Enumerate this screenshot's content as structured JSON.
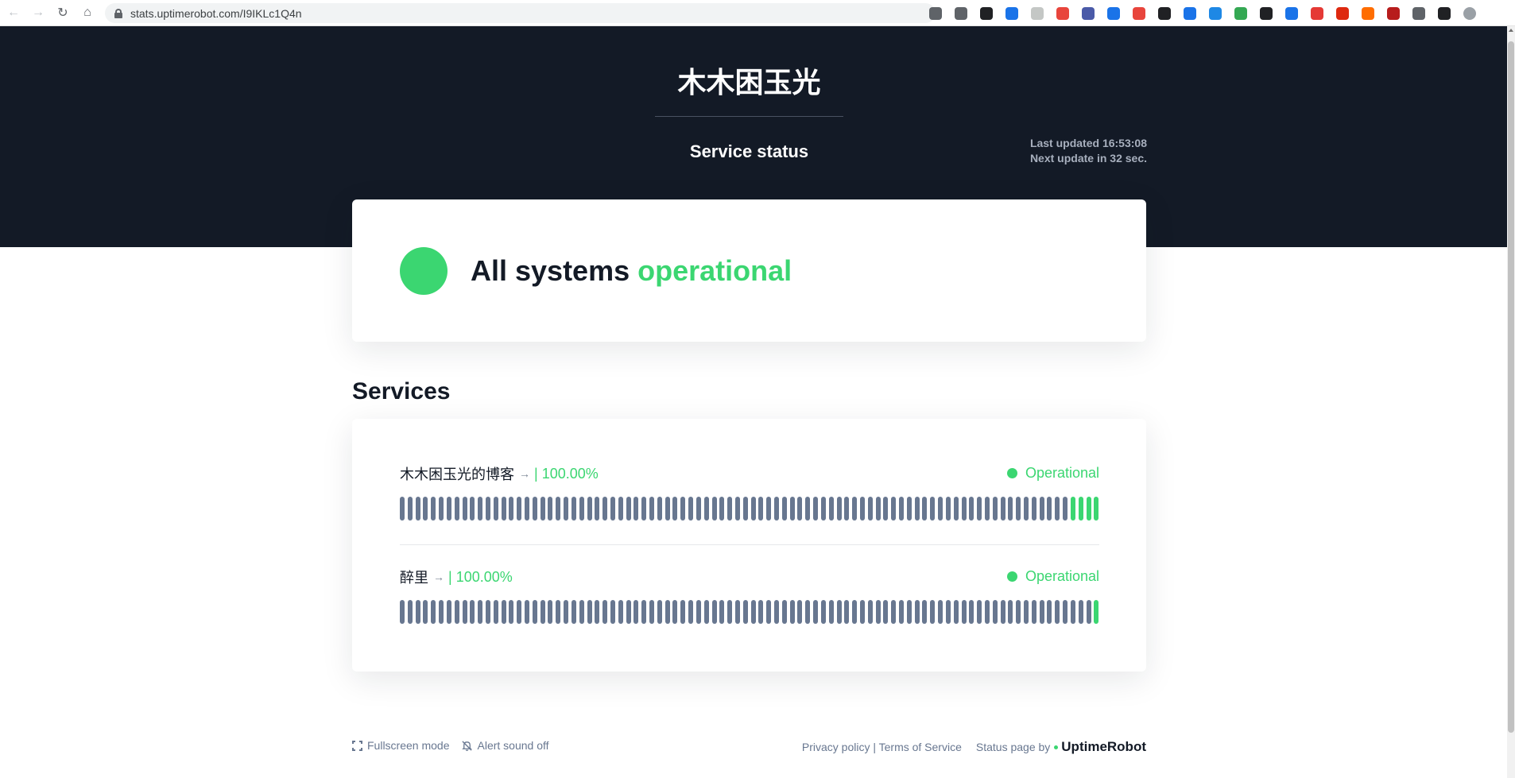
{
  "browser": {
    "url": "stats.uptimerobot.com/I9IKLc1Q4n",
    "extensions": [
      "translate-icon",
      "share-icon",
      "star-icon",
      "edge-icon",
      "cloud-icon",
      "abp-icon",
      "tab-icon",
      "v-icon",
      "grid-icon",
      "notion-icon",
      "bolt-icon",
      "onedrive-icon",
      "globe-icon",
      "scissors-icon",
      "drive-icon",
      "list-icon",
      "flag-icon",
      "stack-icon",
      "vue-icon",
      "puzzle-icon",
      "sidebar-icon",
      "profile-icon"
    ],
    "ext_colors": [
      "#5f6368",
      "#5f6368",
      "#202124",
      "#1a73e8",
      "#c4c7c5",
      "#e8453c",
      "#4a5aa8",
      "#1a73e8",
      "#e8453c",
      "#202124",
      "#1a73e8",
      "#1e88e5",
      "#34a853",
      "#202124",
      "#1a73e8",
      "#e53935",
      "#de2910",
      "#ff6d00",
      "#b71c1c",
      "#5f6368",
      "#202124",
      "#9aa0a6"
    ]
  },
  "header": {
    "site_title": "木木困玉光",
    "page_title": "Service status",
    "last_updated": "Last updated 16:53:08",
    "next_update": "Next update in 32 sec."
  },
  "overall": {
    "prefix": "All systems",
    "status": "operational"
  },
  "services_heading": "Services",
  "services": [
    {
      "name": "木木困玉光的博客",
      "arrow": "→",
      "separator": "|",
      "uptime": "100.00%",
      "state": "Operational",
      "bar_count": 90,
      "green_from_end": 4
    },
    {
      "name": "醉里",
      "arrow": "→",
      "separator": "|",
      "uptime": "100.00%",
      "state": "Operational",
      "bar_count": 90,
      "green_from_end": 1
    }
  ],
  "footer": {
    "fullscreen": "Fullscreen mode",
    "alert": "Alert sound off",
    "policy": "Privacy policy | Terms of Service",
    "status_by": "Status page by",
    "brand": "UptimeRobot"
  },
  "colors": {
    "dark": "#131a26",
    "green": "#3bd671",
    "grey_bar": "#687790"
  }
}
